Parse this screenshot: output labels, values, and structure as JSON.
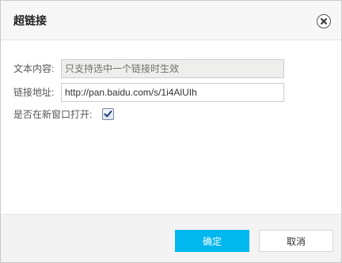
{
  "dialog": {
    "title": "超链接",
    "close_icon": "close-icon"
  },
  "form": {
    "text_label": "文本内容:",
    "text_value": "只支持选中一个链接时生效",
    "url_label": "链接地址:",
    "url_value": "http://pan.baidu.com/s/1i4AlUIh",
    "new_window_label": "是否在新窗口打开:",
    "new_window_checked": true
  },
  "footer": {
    "ok_label": "确定",
    "cancel_label": "取消"
  },
  "colors": {
    "accent": "#00b7ee",
    "readonly_bg": "#eeeeec"
  }
}
